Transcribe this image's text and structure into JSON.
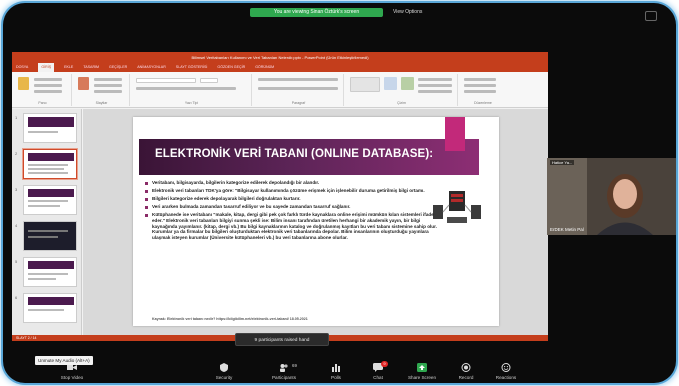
{
  "meeting": {
    "share_banner": "You are viewing Sinan Öztürk's screen",
    "view_options": "View Options",
    "toast": "9 participants raised hand",
    "unmute_tip": "Unmute My Audio (Alt+A)"
  },
  "powerpoint": {
    "title": "Bilimsel Veritabanları Kullanımı ve Veri Tabanları Nelerdir.pptx - PowerPoint (Ürün Etkinleştirilemedi)",
    "tabs": [
      "DOSYA",
      "GİRİŞ",
      "EKLE",
      "TASARIM",
      "GEÇİŞLER",
      "ANİMASYONLAR",
      "SLAYT GÖSTERİSİ",
      "GÖZDEN GEÇİR",
      "GÖRÜNÜM"
    ],
    "active_tab": "GİRİŞ",
    "ribbon_groups": [
      "Pano",
      "Slaytlar",
      "Yazı Tipi",
      "Paragraf",
      "Çizim",
      "Düzenleme"
    ],
    "slide_numbers": [
      "1",
      "2",
      "3",
      "4",
      "5",
      "6"
    ],
    "status": "SLAYT 2 / 14"
  },
  "slide": {
    "title": "ELEKTRONİK VERİ TABANI (ONLINE DATABASE):",
    "bullets": [
      "Veritabanı, bilgisayarda, bilgilerin kategorize edilerek depolandığı bir alandır.",
      "Elektronik veri tabanları TDK'ya göre: \"Bilgisayar kullanımında çözüme erişmek için işlenebilir duruma getirilmiş bilgi ortamı.",
      "Bilgileri kategorize ederek depolayarak bilgileri doğrulaktan kurtarır.",
      "Veri ararken bulmada zamandan tasarruf ediliyor ve bu sayede zamandan tasarruf sağlanır.",
      "Kütüphanede ise veritabanı \"makale, kitap, dergi gibi pek çok farklı türde kaynaklara online erişimi mümkün kılan sistemleri ifade eder.\" Elektronik veri tabanları bilgiyi sunma şekli ise: Bilim insanı tarafından üretilen herhangi bir akademik yayın, bir bilgi kaynağında yayımlanır. (kitap, dergi vb.) Bu bilgi kaynaklarının katalog ve doğrulanmış kayıtları bu veri tabanı sistemine sahip olur. Kurumlar ya da firmalar bu bilgileri oluşturduktan elektronik veri tabanlarında depolar. Bilim insanlarının oluşturduğu yayınlara ulaşmak isteyen kurumlar (Üniversite kütüphaneleri vb.) bu veri tabanlarına abone olurlar."
    ],
    "footer": "Kaynak: Elektronik veri tabanı nedir? https://bilgibilim.net/elektronik-veri-tabani/ 18.05.2021"
  },
  "participant": {
    "top_name": "Hatice Ya...",
    "name": "ErDEK Metin Pal"
  },
  "toolbar": [
    {
      "label": "Stop Video",
      "icon": "video-camera-icon"
    },
    {
      "label": "Security",
      "icon": "shield-icon"
    },
    {
      "label": "Participants",
      "icon": "participants-icon",
      "count": "69"
    },
    {
      "label": "Polls",
      "icon": "polls-icon"
    },
    {
      "label": "Chat",
      "icon": "chat-icon",
      "badge": "9"
    },
    {
      "label": "Share Screen",
      "icon": "share-screen-icon"
    },
    {
      "label": "Record",
      "icon": "record-icon"
    },
    {
      "label": "Reactions",
      "icon": "reactions-icon"
    }
  ],
  "colors": {
    "ppt_accent": "#c43e1c",
    "slide_band": "#5c2457",
    "slide_accent": "#c2297a",
    "share_green": "#2fa84f"
  }
}
